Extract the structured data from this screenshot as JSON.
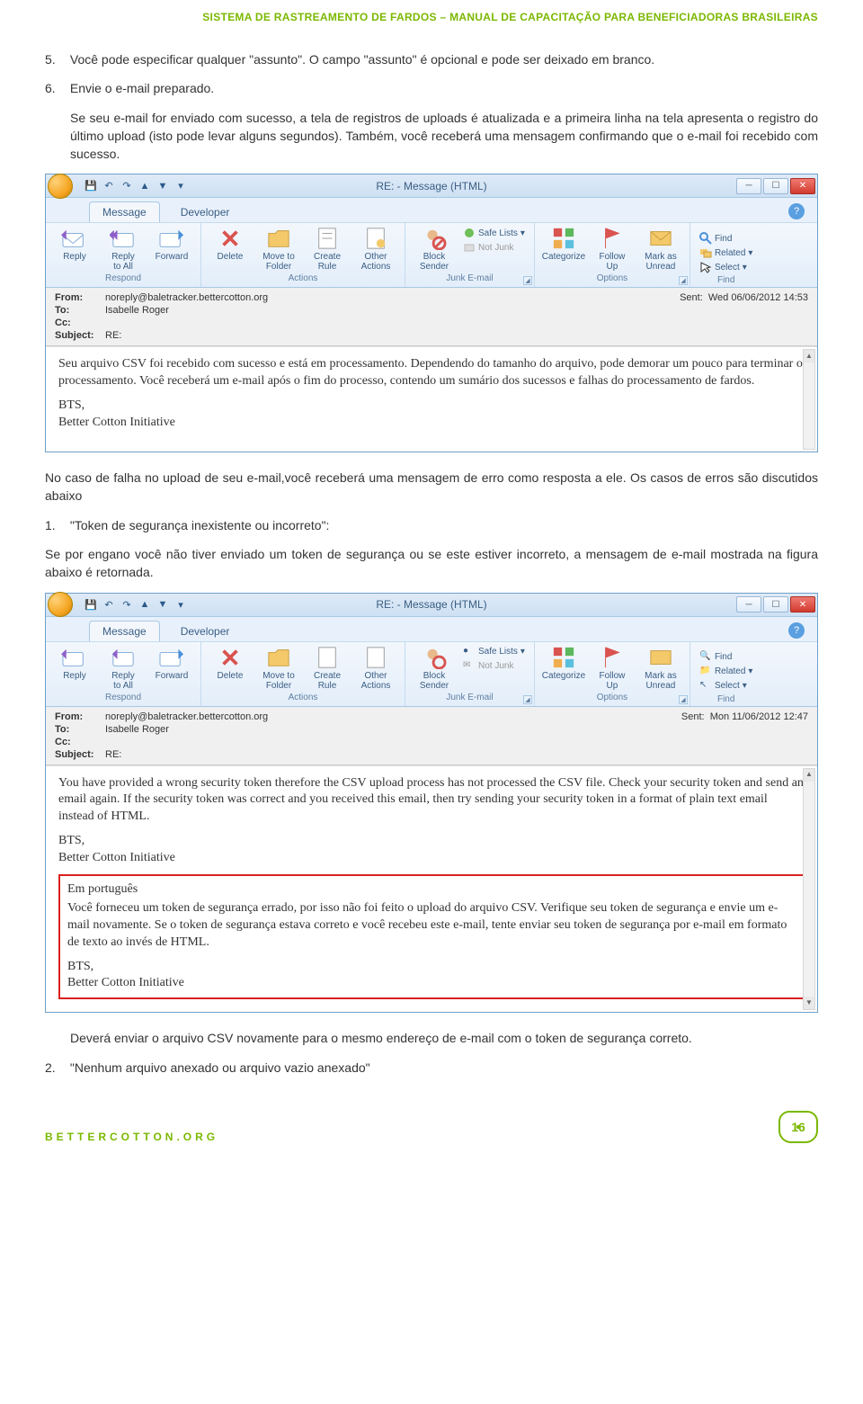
{
  "header": "SISTEMA DE RASTREAMENTO DE FARDOS – MANUAL DE CAPACITAÇÃO PARA BENEFICIADORAS BRASILEIRAS",
  "list": {
    "item5_num": "5.",
    "item5_text": "Você pode especificar qualquer \"assunto\". O campo \"assunto\" é opcional e pode ser deixado em branco.",
    "item6_num": "6.",
    "item6_text": "Envie o e-mail preparado.",
    "item6_after": "Se seu e-mail for enviado com sucesso, a tela de registros de uploads é atualizada e a primeira linha na tela apresenta o registro do último upload (isto pode levar alguns segundos). Também, você receberá uma mensagem confirmando que o e-mail foi recebido com sucesso."
  },
  "email1": {
    "title": "RE: - Message (HTML)",
    "tabs": {
      "message": "Message",
      "developer": "Developer"
    },
    "ribbon": {
      "respond": {
        "reply": "Reply",
        "reply_all": "Reply\nto All",
        "forward": "Forward",
        "group": "Respond"
      },
      "actions": {
        "delete": "Delete",
        "move": "Move to\nFolder",
        "create": "Create\nRule",
        "other": "Other\nActions",
        "group": "Actions"
      },
      "junk": {
        "block": "Block\nSender",
        "safe": "Safe Lists",
        "notjunk": "Not Junk",
        "group": "Junk E-mail"
      },
      "options": {
        "categorize": "Categorize",
        "follow": "Follow\nUp",
        "mark": "Mark as\nUnread",
        "group": "Options"
      },
      "find": {
        "find": "Find",
        "related": "Related",
        "select": "Select",
        "group": "Find"
      }
    },
    "hdr": {
      "from_l": "From:",
      "from_v": "noreply@baletracker.bettercotton.org",
      "to_l": "To:",
      "to_v": "Isabelle Roger",
      "cc_l": "Cc:",
      "cc_v": "",
      "subj_l": "Subject:",
      "subj_v": "RE:",
      "sent_l": "Sent:",
      "sent_v": "Wed 06/06/2012 14:53"
    },
    "body": {
      "p1": "Seu arquivo CSV foi recebido com sucesso e está em processamento. Dependendo do tamanho do arquivo, pode demorar um pouco para terminar o processamento. Você receberá um e-mail após o fim do processo, contendo um sumário dos sucessos e falhas do processamento de fardos.",
      "p2": "BTS,",
      "p3": "Better Cotton Initiative"
    }
  },
  "mid": {
    "p1": "No caso de falha no upload de seu e-mail,você receberá uma mensagem de erro como resposta a ele. Os casos de erros são discutidos abaixo",
    "item1_num": "1.",
    "item1_text": "\"Token de segurança inexistente ou incorreto\":",
    "p2": "Se por engano você não tiver enviado um token de segurança ou se este estiver incorreto, a mensagem de e-mail mostrada na figura abaixo é retornada."
  },
  "email2": {
    "hdr": {
      "from_v": "noreply@baletracker.bettercotton.org",
      "to_v": "Isabelle Roger",
      "subj_v": "RE:",
      "sent_v": "Mon 11/06/2012 12:47"
    },
    "body": {
      "p1": "You have provided a wrong security token therefore the CSV upload process has not processed the CSV file. Check your security token and send an email again. If the security token was correct and you received this email, then try sending your security token in a format of plain text email instead of HTML.",
      "p2": "BTS,",
      "p3": "Better Cotton Initiative",
      "pt_h": "Em português",
      "pt1": "Você forneceu um token de segurança errado, por isso não foi feito o upload do arquivo CSV. Verifique seu token de segurança e envie um e-mail novamente. Se o token de segurança estava correto e você recebeu este e-mail, tente enviar seu token de segurança por e-mail em formato de texto ao invés de HTML.",
      "pt2": "BTS,",
      "pt3": "Better Cotton Initiative"
    }
  },
  "closing": {
    "p1": "Deverá enviar o arquivo CSV novamente para o mesmo endereço de e-mail com o token de segurança correto.",
    "item2_num": "2.",
    "item2_text": "\"Nenhum arquivo anexado ou arquivo vazio anexado\""
  },
  "footer": {
    "link": "BETTERCOTTON.ORG",
    "page": "16"
  }
}
